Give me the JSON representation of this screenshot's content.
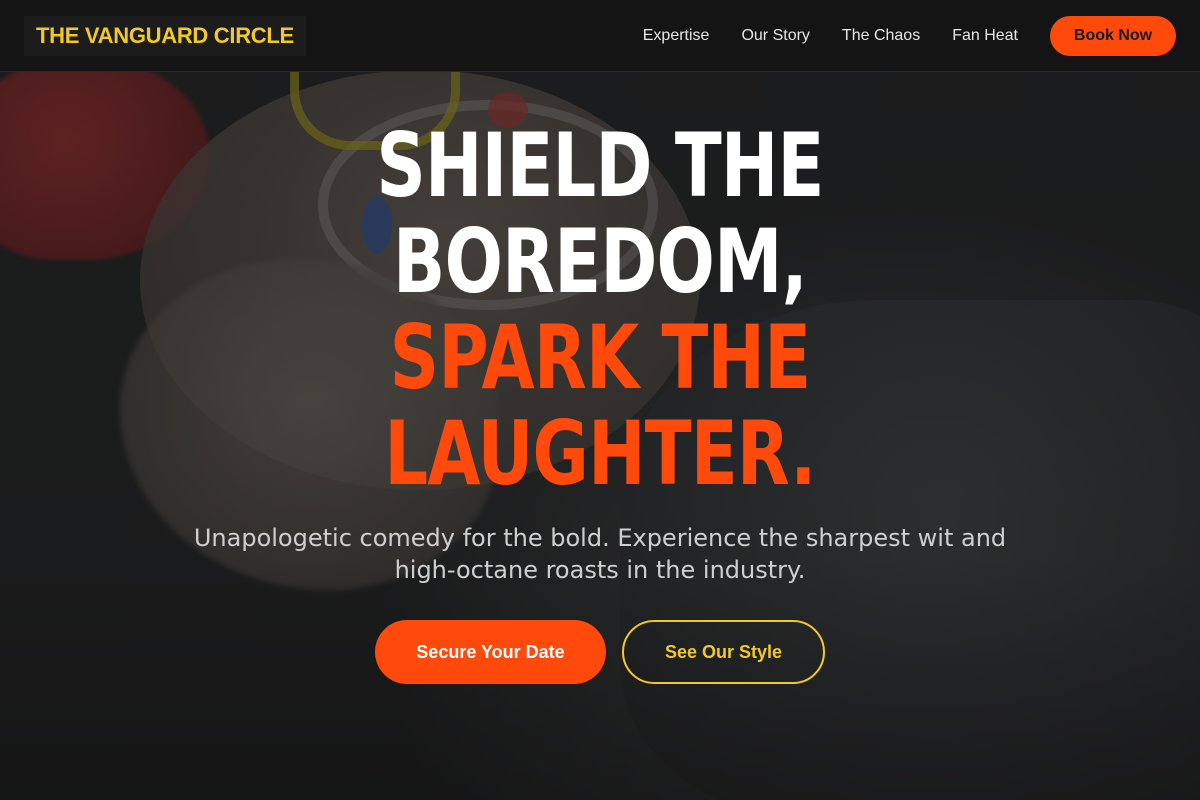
{
  "brand": {
    "name": "THE VANGUARD CIRCLE"
  },
  "nav": {
    "links": [
      "Expertise",
      "Our Story",
      "The Chaos",
      "Fan Heat"
    ],
    "cta": "Book Now"
  },
  "hero": {
    "headline_white": [
      "SHIELD THE",
      "BOREDOM,"
    ],
    "headline_orange": [
      "SPARK THE",
      "LAUGHTER."
    ],
    "subtitle": "Unapologetic comedy for the bold. Experience the sharpest wit and high-octane roasts in the industry.",
    "primary_button": "Secure Your Date",
    "secondary_button": "See Our Style"
  },
  "colors": {
    "accent_orange": "#ff4a0b",
    "accent_yellow": "#f2c92a",
    "nav_background": "#141414"
  }
}
